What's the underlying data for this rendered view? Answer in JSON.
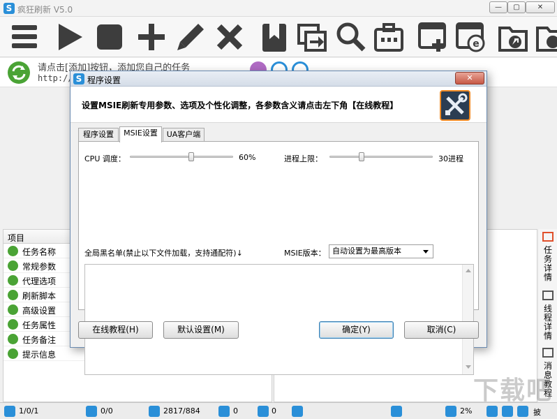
{
  "window": {
    "title": "疯狂刷新 V5.0",
    "logo_letter": "S",
    "minimize": "—",
    "maximize": "▢",
    "close": "✕"
  },
  "toolbar": {
    "icons": [
      "menu-icon",
      "play-icon",
      "stop-icon",
      "add-icon",
      "edit-icon",
      "delete-icon",
      "bookmark-icon",
      "copy-window-icon",
      "search-icon",
      "briefcase-icon",
      "new-window-icon",
      "ie-icon",
      "folder-export-icon",
      "folder-refresh-icon"
    ]
  },
  "hint": {
    "line1": "请点击[添加]按钮，添加您自己的任务",
    "line2": "http://"
  },
  "task_props": {
    "header": "项目",
    "items": [
      "任务名称",
      "常规参数",
      "代理选项",
      "刷新脚本",
      "高级设置",
      "任务属性",
      "任务备注",
      "提示信息"
    ]
  },
  "side_tabs": [
    "任务详情",
    "线程详情",
    "消息教程"
  ],
  "status": {
    "tasks": "1/0/1",
    "refresh": "0/0",
    "threads": "2817/884",
    "down": "0",
    "ie": "0",
    "cpu": "2%",
    "tail": "披"
  },
  "watermark": "下载吧",
  "dialog": {
    "title": "程序设置",
    "close": "✕",
    "description": "设置MSIE刷新专用参数、选项及个性化调整，各参数含义请点击左下角【在线教程】",
    "tabs": [
      "程序设置",
      "MSIE设置",
      "UA客户端"
    ],
    "active_tab": "MSIE设置",
    "cpu_label": "CPU 调度：",
    "cpu_value": "60%",
    "cpu_fraction": 0.6,
    "proc_label": "进程上限：",
    "proc_value": "30进程",
    "proc_fraction": 0.3,
    "blacklist_label": "全局黑名单(禁止以下文件加载，支持通配符)↓",
    "msie_label": "MSIE版本：",
    "msie_selected": "自动设置为最高版本",
    "buttons": {
      "online": "在线教程(H)",
      "default": "默认设置(M)",
      "ok": "确定(Y)",
      "cancel": "取消(C)"
    }
  }
}
